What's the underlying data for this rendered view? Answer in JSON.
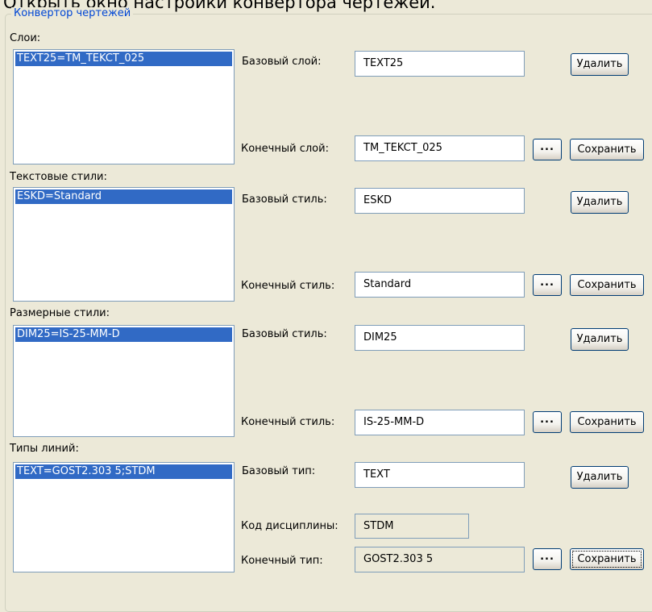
{
  "header": {
    "caption": "Открыть окно настройки конвертора чертежей."
  },
  "group": {
    "title": "Конвертор чертежей"
  },
  "layers": {
    "section_label": "Слои:",
    "list_item": "TEXT25=TM_TEKCT_025",
    "base_label": "Базовый слой:",
    "base_value": "TEXT25",
    "target_label": "Конечный слой:",
    "target_value": "TM_TEKCT_025",
    "delete_label": "Удалить",
    "browse_label": "...",
    "save_label": "Сохранить"
  },
  "text_styles": {
    "section_label": "Текстовые стили:",
    "list_item": "ESKD=Standard",
    "base_label": "Базовый стиль:",
    "base_value": "ESKD",
    "target_label": "Конечный стиль:",
    "target_value": "Standard",
    "delete_label": "Удалить",
    "browse_label": "...",
    "save_label": "Сохранить"
  },
  "dim_styles": {
    "section_label": "Размерные стили:",
    "list_item": "DIM25=IS-25-MM-D",
    "base_label": "Базовый стиль:",
    "base_value": "DIM25",
    "target_label": "Конечный стиль:",
    "target_value": "IS-25-MM-D",
    "delete_label": "Удалить",
    "browse_label": "...",
    "save_label": "Сохранить"
  },
  "line_types": {
    "section_label": "Типы линий:",
    "list_item": "TEXT=GOST2.303 5;STDM",
    "base_label": "Базовый тип:",
    "base_value": "TEXT",
    "discipline_label": "Код дисциплины:",
    "discipline_value": "STDM",
    "target_label": "Конечный тип:",
    "target_value": "GOST2.303 5",
    "delete_label": "Удалить",
    "browse_label": "...",
    "save_label": "Сохранить"
  },
  "colors": {
    "window_bg": "#ece9d8",
    "selection": "#316ac5",
    "group_title": "#0046d5",
    "field_border": "#7f9db9"
  }
}
